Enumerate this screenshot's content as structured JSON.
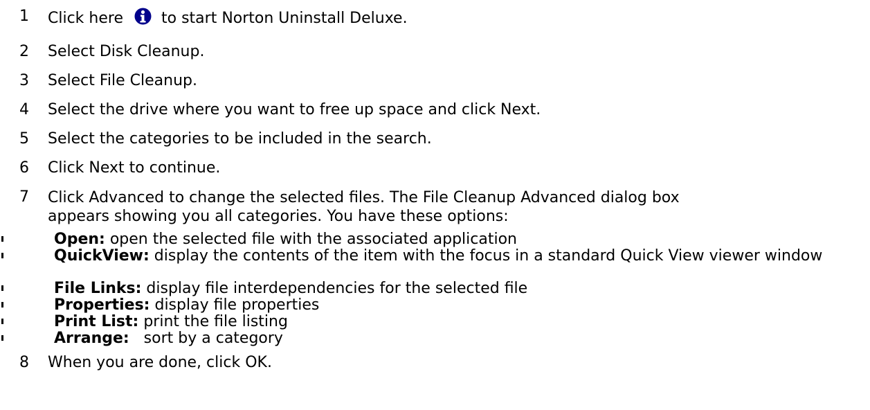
{
  "colors": {
    "text": "#000000",
    "background": "#ffffff",
    "info_icon_fill": "#00008b",
    "info_icon_glyph": "#ffffff"
  },
  "icons": {
    "info": "info-icon"
  },
  "steps": [
    {
      "num": "1",
      "before": "Click here",
      "after": "to start Norton Uninstall Deluxe."
    },
    {
      "num": "2",
      "text": "Select Disk Cleanup."
    },
    {
      "num": "3",
      "text": "Select File Cleanup."
    },
    {
      "num": "4",
      "text": "Select the drive where you want to free up space and click Next."
    },
    {
      "num": "5",
      "text": "Select the categories to be included in the search."
    },
    {
      "num": "6",
      "text": "Click Next to continue."
    },
    {
      "num": "7",
      "text": "Click Advanced to change the selected files. The File Cleanup Advanced dialog box appears showing you all categories. You have these options:"
    },
    {
      "num": "8",
      "text": "When you are done, click OK."
    }
  ],
  "options": [
    {
      "term": "Open:",
      "desc": " open the selected file with the associated application"
    },
    {
      "term": "QuickView:",
      "desc": " display the contents of the item with the focus in a standard Quick View viewer window"
    },
    {
      "term": "File Links:",
      "desc": " display file interdependencies for the selected file"
    },
    {
      "term": "Properties:",
      "desc": " display file properties"
    },
    {
      "term": "Print List:",
      "desc": " print the file listing"
    },
    {
      "term": "Arrange:",
      "desc": "   sort by a category"
    }
  ]
}
